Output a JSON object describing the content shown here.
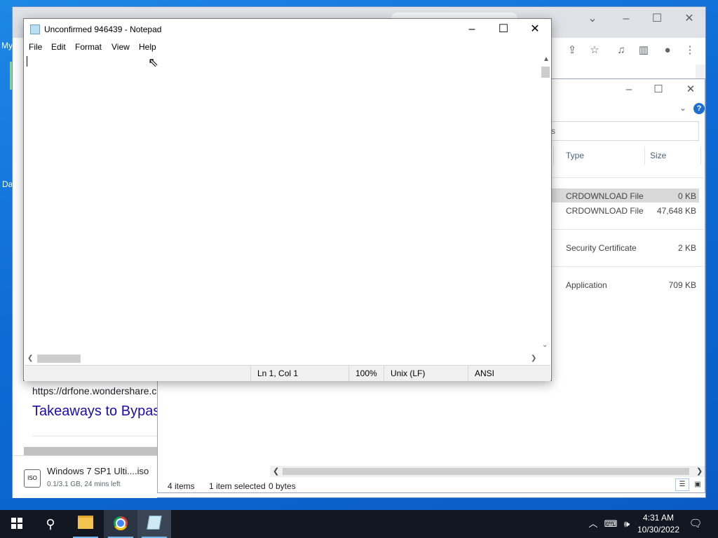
{
  "desktop": {
    "labels": [
      "My",
      "Da"
    ]
  },
  "chrome": {
    "page_url": "https://drfone.wondershare.c",
    "page_title": "Takeaways to Bypas",
    "download": {
      "name": "Windows 7 SP1 Ulti....iso",
      "status": "0.1/3.1 GB, 24 mins left",
      "icon_text": "ISO"
    },
    "toolbar_icons": [
      "chrome-ctl-chevron-icon",
      "share-icon",
      "star-icon",
      "media-icon",
      "sidepanel-icon",
      "profile-icon",
      "more-icon"
    ]
  },
  "explorer": {
    "search_text": "s",
    "columns": {
      "type": "Type",
      "size": "Size"
    },
    "rows": [
      {
        "type": "CRDOWNLOAD File",
        "size": "0 KB"
      },
      {
        "type": "CRDOWNLOAD File",
        "size": "47,648 KB"
      },
      {
        "type": "Security Certificate",
        "size": "2 KB"
      },
      {
        "type": "Application",
        "size": "709 KB"
      }
    ],
    "status": {
      "items": "4 items",
      "selected": "1 item selected",
      "bytes": "0 bytes"
    },
    "help": "?"
  },
  "notepad": {
    "title": "Unconfirmed 946439 - Notepad",
    "menu": [
      "File",
      "Edit",
      "Format",
      "View",
      "Help"
    ],
    "status": {
      "position": "Ln 1, Col 1",
      "zoom": "100%",
      "eol": "Unix (LF)",
      "encoding": "ANSI"
    }
  },
  "taskbar": {
    "time": "4:31 AM",
    "date": "10/30/2022"
  },
  "colors": {
    "desktop_blue": "#0d6ad6",
    "taskbar": "#121722",
    "link": "#1a0dab",
    "selected_row": "#d9d9d9"
  }
}
